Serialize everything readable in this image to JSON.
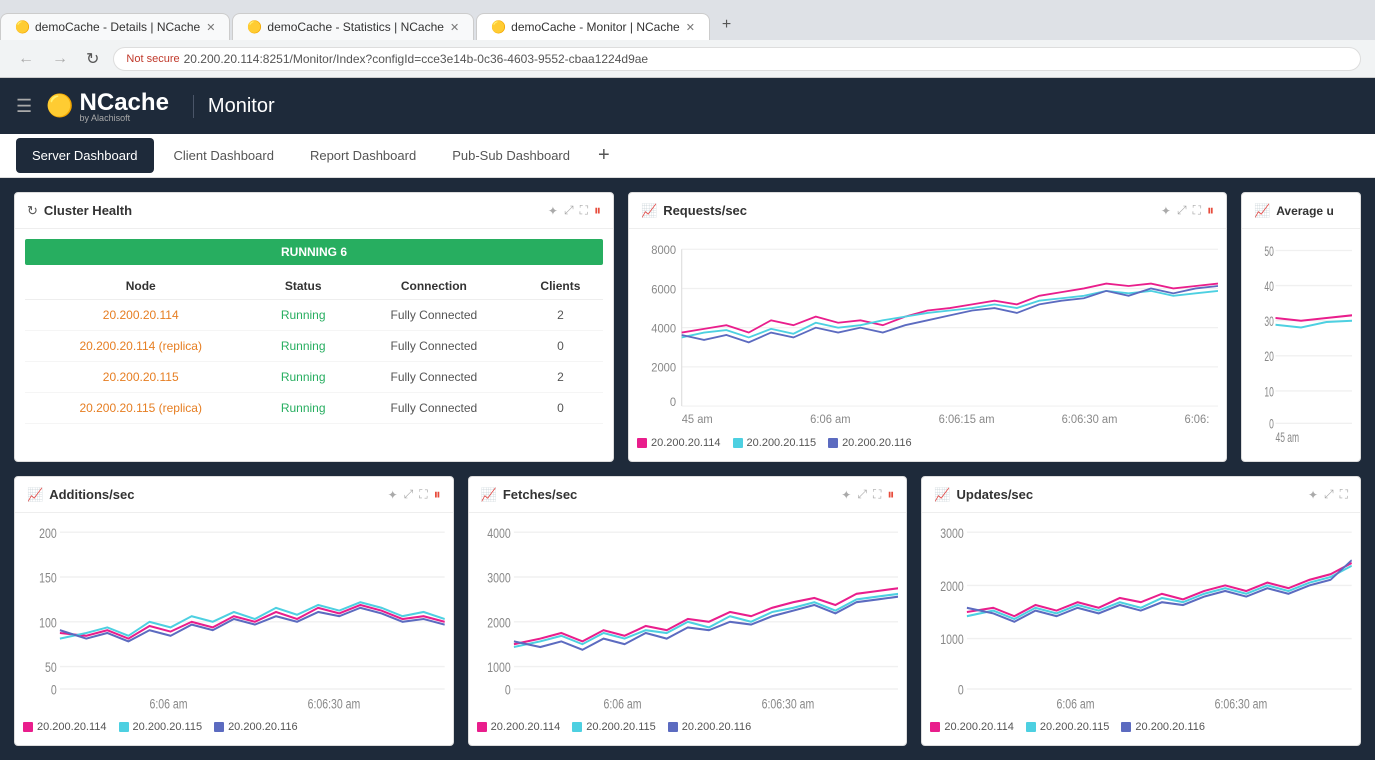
{
  "browser": {
    "tabs": [
      {
        "label": "demoCache - Details | NCache",
        "active": false,
        "id": "tab-details"
      },
      {
        "label": "demoCache - Statistics | NCache",
        "active": false,
        "id": "tab-stats"
      },
      {
        "label": "demoCache - Monitor | NCache",
        "active": true,
        "id": "tab-monitor"
      }
    ],
    "url": "20.200.20.114:8251/Monitor/Index?configId=cce3e14b-0c36-4603-9552-cbaa1224d9ae",
    "security_warning": "Not secure"
  },
  "app": {
    "title": "Monitor",
    "logo": "NCache",
    "logo_sub": "by Alachisoft"
  },
  "nav": {
    "tabs": [
      {
        "label": "Server Dashboard",
        "active": true
      },
      {
        "label": "Client Dashboard",
        "active": false
      },
      {
        "label": "Report Dashboard",
        "active": false
      },
      {
        "label": "Pub-Sub Dashboard",
        "active": false
      }
    ],
    "add_label": "+"
  },
  "cluster_health": {
    "title": "Cluster Health",
    "status": "RUNNING 6",
    "columns": [
      "Node",
      "Status",
      "Connection",
      "Clients"
    ],
    "rows": [
      {
        "node": "20.200.20.114",
        "status": "Running",
        "connection": "Fully Connected",
        "clients": "2"
      },
      {
        "node": "20.200.20.114 (replica)",
        "status": "Running",
        "connection": "Fully Connected",
        "clients": "0"
      },
      {
        "node": "20.200.20.115",
        "status": "Running",
        "connection": "Fully Connected",
        "clients": "2"
      },
      {
        "node": "20.200.20.115 (replica)",
        "status": "Running",
        "connection": "Fully Connected",
        "clients": "0"
      }
    ]
  },
  "charts": {
    "requests": {
      "title": "Requests/sec",
      "y_max": 8000,
      "y_labels": [
        "8000",
        "6000",
        "4000",
        "2000",
        "0"
      ],
      "x_labels": [
        "45 am",
        "6:06 am",
        "6:06:15 am",
        "6:06:30 am",
        "6:06:"
      ]
    },
    "avg_u": {
      "title": "Average u",
      "y_max": 50,
      "y_labels": [
        "50",
        "40",
        "30",
        "20",
        "10",
        "0"
      ]
    },
    "additions": {
      "title": "Additions/sec",
      "y_max": 200,
      "y_labels": [
        "200",
        "150",
        "100",
        "50",
        "0"
      ],
      "x_labels": [
        "6:06 am",
        "6:06:30 am"
      ]
    },
    "fetches": {
      "title": "Fetches/sec",
      "y_max": 4000,
      "y_labels": [
        "4000",
        "3000",
        "2000",
        "1000",
        "0"
      ],
      "x_labels": [
        "6:06 am",
        "6:06:30 am"
      ]
    },
    "updates": {
      "title": "Updates/sec",
      "y_max": 3000,
      "y_labels": [
        "3000",
        "2000",
        "1000",
        "0"
      ],
      "x_labels": [
        "6:06 am",
        "6:06:30 am"
      ]
    }
  },
  "legend": {
    "nodes": [
      {
        "label": "20.200.20.114",
        "color": "#e91e8c"
      },
      {
        "label": "20.200.20.115",
        "color": "#4dd0e1"
      },
      {
        "label": "20.200.20.116",
        "color": "#5c6bc0"
      }
    ]
  },
  "icons": {
    "chart": "📈",
    "refresh": "↻",
    "expand": "⤢",
    "fullscreen": "⛶",
    "pause": "⏸",
    "hamburger": "☰",
    "shield": "🔒",
    "back": "←",
    "forward": "→",
    "reload": "↻"
  }
}
